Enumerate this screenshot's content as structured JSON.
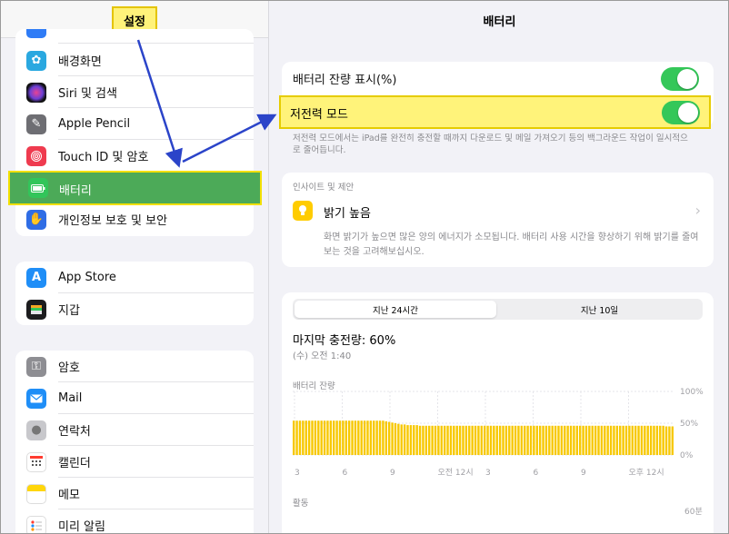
{
  "sidebar": {
    "title": "설정",
    "group1": [
      "배경화면",
      "Siri 및 검색",
      "Apple Pencil",
      "Touch ID 및 암호",
      "배터리",
      "개인정보 보호 및 보안"
    ],
    "group2": [
      "App Store",
      "지갑"
    ],
    "group3": [
      "암호",
      "Mail",
      "연락처",
      "캘린더",
      "메모",
      "미리 알림"
    ],
    "selected_index": 4
  },
  "main": {
    "title": "배터리",
    "percent_row": {
      "label": "배터리 잔량 표시(%)",
      "on": true
    },
    "low_power": {
      "label": "저전력 모드",
      "on": true
    },
    "low_power_desc": "저전력 모드에서는 iPad를 완전히 충전할 때까지 다운로드 및 메일 가져오기 등의 백그라운드 작업이 일시적으로 줄어듭니다.",
    "insights": {
      "header": "인사이트 및 제안",
      "item": "밝기 높음",
      "body": "화면 밝기가 높으면 많은 양의 에너지가 소모됩니다. 배터리 사용 시간을 향상하기 위해 밝기를 줄여보는 것을 고려해보십시오."
    },
    "tabs": [
      "지난 24시간",
      "지난 10일"
    ],
    "last_charge": "마지막 충전량: 60%",
    "last_charge_time": "(수) 오전 1:40",
    "battery_level_label": "배터리 잔량",
    "activity_label": "활동",
    "activity_max": "60분"
  },
  "chart_data": {
    "type": "bar",
    "title": "배터리 잔량",
    "yticks": [
      "100%",
      "50%",
      "0%"
    ],
    "ylim": [
      0,
      100
    ],
    "xticks": [
      "3",
      "6",
      "9",
      "오전 12시",
      "3",
      "6",
      "9",
      "오후 12시"
    ],
    "values": [
      54,
      54,
      54,
      54,
      54,
      54,
      54,
      54,
      54,
      54,
      54,
      54,
      54,
      54,
      54,
      54,
      54,
      54,
      54,
      54,
      54,
      54,
      54,
      54,
      54,
      54,
      54,
      54,
      54,
      54,
      53,
      52,
      51,
      50,
      49,
      48,
      48,
      47,
      47,
      47,
      47,
      46,
      46,
      46,
      46,
      46,
      46,
      46,
      46,
      46,
      46,
      46,
      46,
      46,
      46,
      46,
      46,
      46,
      46,
      46,
      46,
      46,
      46,
      46,
      46,
      46,
      46,
      46,
      46,
      46,
      46,
      46,
      46,
      46,
      46,
      46,
      46,
      46,
      46,
      46,
      46,
      46,
      46,
      46,
      46,
      46,
      46,
      46,
      46,
      46,
      46,
      46,
      46,
      46,
      46,
      46,
      46,
      46,
      46,
      46,
      46,
      46,
      46,
      46,
      46,
      46,
      46,
      46,
      46,
      46,
      46,
      46,
      46,
      46,
      46,
      46,
      46,
      46,
      46,
      46,
      46,
      45,
      45,
      45
    ]
  }
}
